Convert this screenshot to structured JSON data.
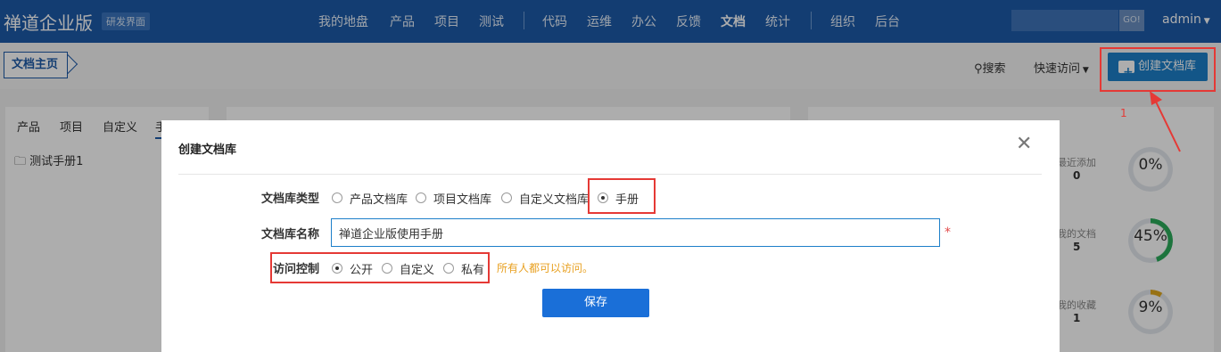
{
  "header": {
    "brand": "禅道企业版",
    "badge": "研发界面",
    "nav": [
      "我的地盘",
      "产品",
      "项目",
      "测试",
      "代码",
      "运维",
      "办公",
      "反馈",
      "文档",
      "统计",
      "组织",
      "后台"
    ],
    "go_label": "GO!",
    "user": "admin"
  },
  "subbar": {
    "breadcrumb": "文档主页",
    "search_label": "搜索",
    "quick_access_label": "快速访问",
    "create_label": "创建文档库"
  },
  "sidebar": {
    "tabs": [
      "产品",
      "项目",
      "自定义",
      "手册"
    ],
    "tree_item": "测试手册1"
  },
  "stats": [
    {
      "label": "最近添加",
      "value": "0",
      "percent": "0%",
      "color": "#e4e8ee",
      "fraction": 0.0
    },
    {
      "label": "我的文档",
      "value": "5",
      "percent": "45%",
      "color": "#2bab5b",
      "fraction": 0.45
    },
    {
      "label": "我的收藏",
      "value": "1",
      "percent": "9%",
      "color": "#e0a81e",
      "fraction": 0.09
    }
  ],
  "modal": {
    "title": "创建文档库",
    "type_label": "文档库类型",
    "type_options": [
      "产品文档库",
      "项目文档库",
      "自定义文档库",
      "手册"
    ],
    "type_selected": "手册",
    "name_label": "文档库名称",
    "name_value": "禅道企业版使用手册",
    "required_mark": "*",
    "access_label": "访问控制",
    "access_options": [
      "公开",
      "自定义",
      "私有"
    ],
    "access_selected": "公开",
    "access_hint": "所有人都可以访问。",
    "save_label": "保存"
  },
  "annotation": {
    "step_number": "1"
  },
  "colors": {
    "nav_bg": "#1d5aa8",
    "primary": "#1d7fc9",
    "save": "#1a6fd8",
    "highlight": "#e53935",
    "hint": "#e8a020"
  }
}
